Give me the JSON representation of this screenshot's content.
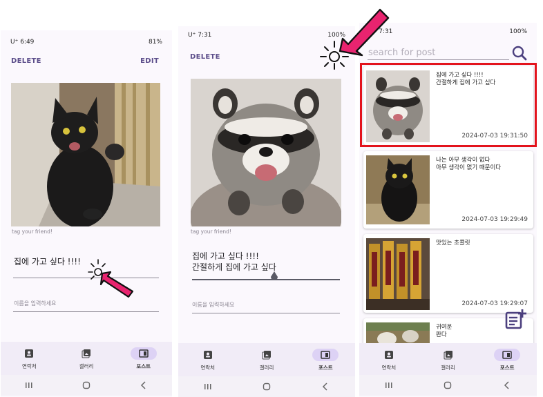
{
  "colors": {
    "accent": "#5b4d8a",
    "nav_active": "#ddd2f5",
    "highlight": "#e3131c",
    "pointer": "#e8246f"
  },
  "phone1": {
    "status_left": "U⁺ 6:49",
    "status_right": "81%",
    "delete_label": "DELETE",
    "edit_label": "EDIT",
    "image_icon": "black-cat-photo",
    "tag_hint": "tag your friend!",
    "post_text": "집에 가고 싶다 !!!!",
    "name_placeholder": "이름을 입력하세요"
  },
  "phone2": {
    "status_left": "U⁺ 7:31",
    "status_right": "100%",
    "delete_label": "DELETE",
    "image_icon": "raccoon-photo",
    "tag_hint": "tag your friend!",
    "post_text": "집에 가고 싶다 !!!!\n간절하게 집에 가고 싶다",
    "name_placeholder": "이름을 입력하세요"
  },
  "phone3": {
    "status_left": "U⁺ 7:31",
    "status_right": "100%",
    "search_placeholder": "search for post",
    "posts": [
      {
        "text": "집에 가고 싶다 !!!!\n간절하게 집에 가고 싶다",
        "time": "2024-07-03 19:31:50",
        "image_icon": "raccoon-photo"
      },
      {
        "text": "나는 아무 생각이 없다\n아무 생각이 없기 때문이다",
        "time": "2024-07-03 19:29:49",
        "image_icon": "black-cat-photo"
      },
      {
        "text": "맛있는 초콜릿",
        "time": "2024-07-03 19:29:07",
        "image_icon": "chocolate-photo"
      },
      {
        "text": "귀여운\n판다",
        "time": "",
        "image_icon": "panda-photo"
      }
    ]
  },
  "nav": {
    "contacts": "연락처",
    "gallery": "갤러리",
    "posts": "포스트"
  }
}
